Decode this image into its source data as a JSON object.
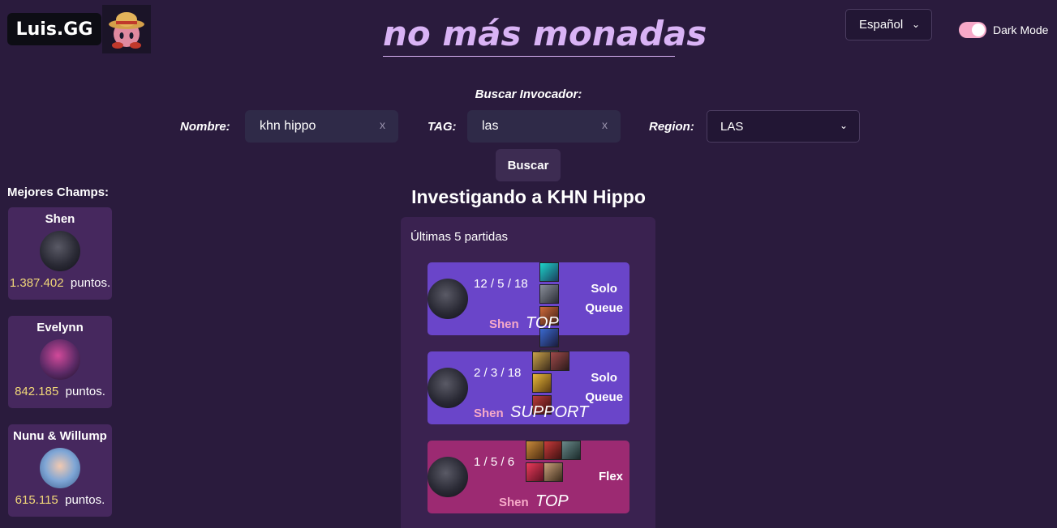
{
  "header": {
    "logo_text": "Luis.GG",
    "title": "no más monadas",
    "language": "Español",
    "dark_mode_label": "Dark Mode",
    "dark_mode_on": true
  },
  "search": {
    "heading": "Buscar Invocador:",
    "name_label": "Nombre:",
    "name_value": "khn hippo",
    "tag_label": "TAG:",
    "tag_value": "las",
    "clear_glyph": "x",
    "region_label": "Region:",
    "region_value": "LAS",
    "button_label": "Buscar"
  },
  "best_champs": {
    "title": "Mejores Champs:",
    "points_suffix": "puntos.",
    "items": [
      {
        "name": "Shen",
        "points": "1.387.402"
      },
      {
        "name": "Evelynn",
        "points": "842.185"
      },
      {
        "name": "Nunu & Willump",
        "points": "615.115"
      }
    ]
  },
  "investigating": {
    "title": "Investigando a KHN Hippo",
    "panel_title": "Últimas 5 partidas",
    "matches": [
      {
        "kda": "12 / 5 / 18",
        "queue_line1": "Solo",
        "queue_line2": "Queue",
        "champion": "Shen",
        "role": "TOP",
        "color": "#6a45c9"
      },
      {
        "kda": "2 / 3 / 18",
        "queue_line1": "Solo",
        "queue_line2": "Queue",
        "champion": "Shen",
        "role": "SUPPORT",
        "color": "#6a45c9"
      },
      {
        "kda": "1 / 5 / 6",
        "queue_line1": "Flex",
        "queue_line2": "",
        "champion": "Shen",
        "role": "TOP",
        "color": "#9c2a72"
      }
    ]
  },
  "colors": {
    "background": "#2a1b3d",
    "accent_title": "#d9b3f5",
    "toggle": "#f6a9c8",
    "points": "#f1d778"
  }
}
